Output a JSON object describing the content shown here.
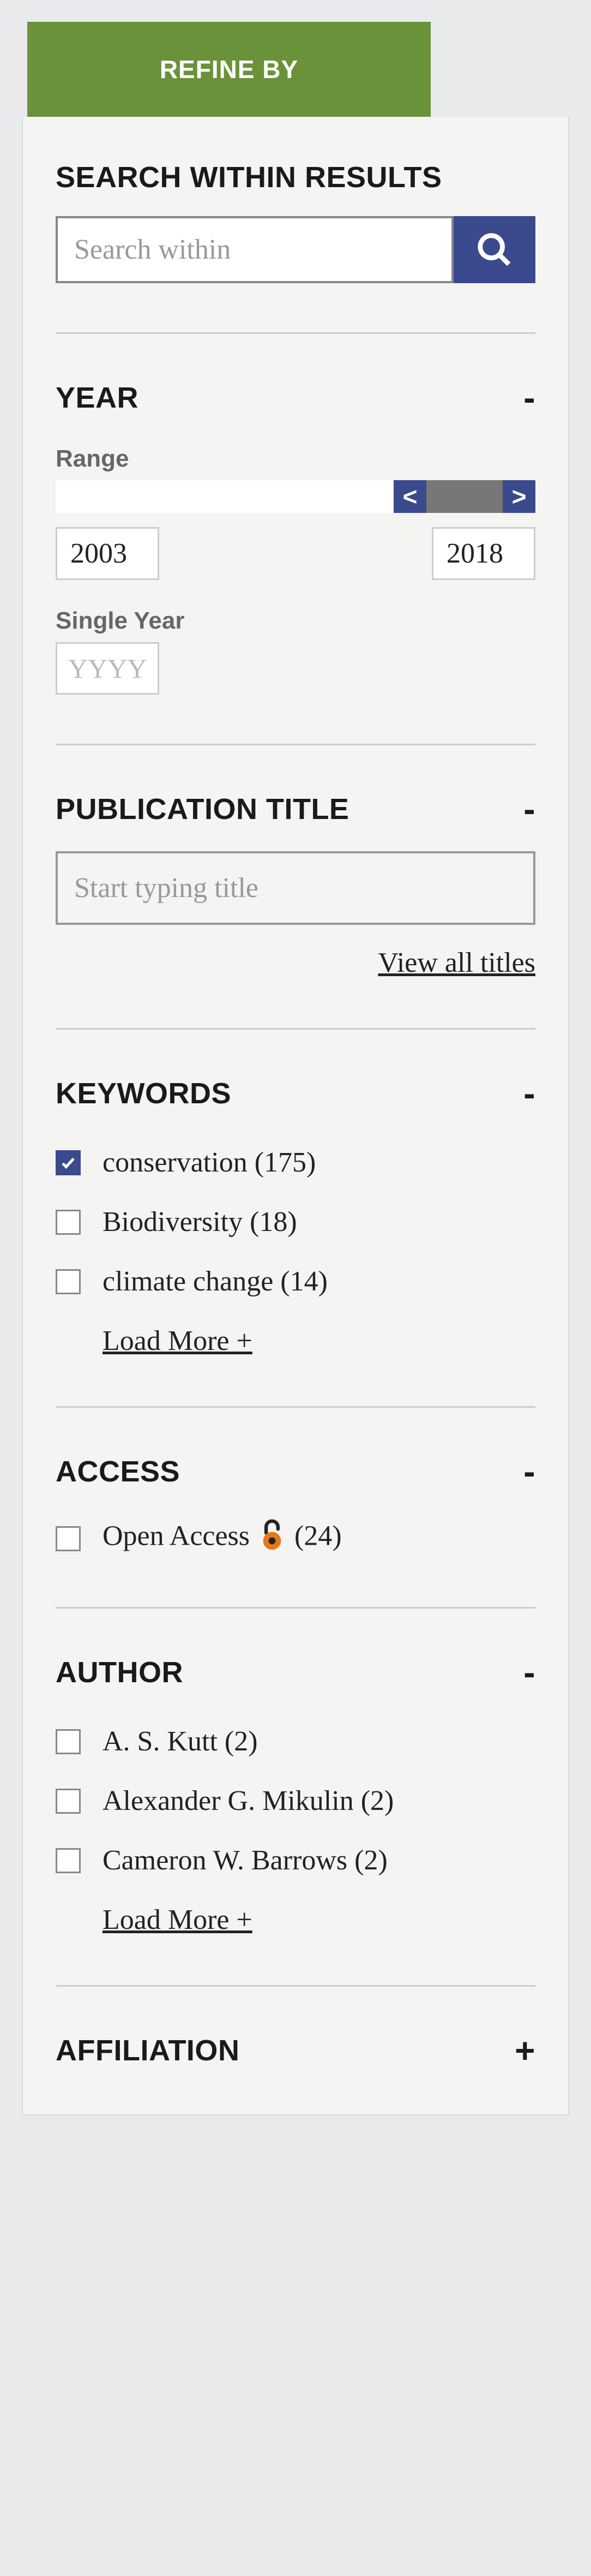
{
  "header": {
    "refine_by": "REFINE BY"
  },
  "search_within": {
    "title": "SEARCH WITHIN RESULTS",
    "placeholder": "Search within"
  },
  "year": {
    "title": "YEAR",
    "toggle": "-",
    "range_label": "Range",
    "lt": "<",
    "gt": ">",
    "from": "2003",
    "to": "2018",
    "single_label": "Single Year",
    "single_placeholder": "YYYY"
  },
  "pub_title": {
    "title": "PUBLICATION TITLE",
    "toggle": "-",
    "placeholder": "Start typing title",
    "view_all": "View all titles"
  },
  "keywords": {
    "title": "KEYWORDS",
    "toggle": "-",
    "items": [
      {
        "label": "conservation (175)",
        "checked": true
      },
      {
        "label": "Biodiversity (18)",
        "checked": false
      },
      {
        "label": "climate change (14)",
        "checked": false
      }
    ],
    "load_more": "Load More +"
  },
  "access": {
    "title": "ACCESS",
    "toggle": "-",
    "items": [
      {
        "label_pre": "Open Access",
        "label_post": "(24)",
        "checked": false
      }
    ]
  },
  "author": {
    "title": "AUTHOR",
    "toggle": "-",
    "items": [
      {
        "label": "A. S. Kutt (2)",
        "checked": false
      },
      {
        "label": "Alexander G. Mikulin (2)",
        "checked": false
      },
      {
        "label": "Cameron W. Barrows (2)",
        "checked": false
      }
    ],
    "load_more": "Load More +"
  },
  "affiliation": {
    "title": "AFFILIATION",
    "toggle": "+"
  }
}
